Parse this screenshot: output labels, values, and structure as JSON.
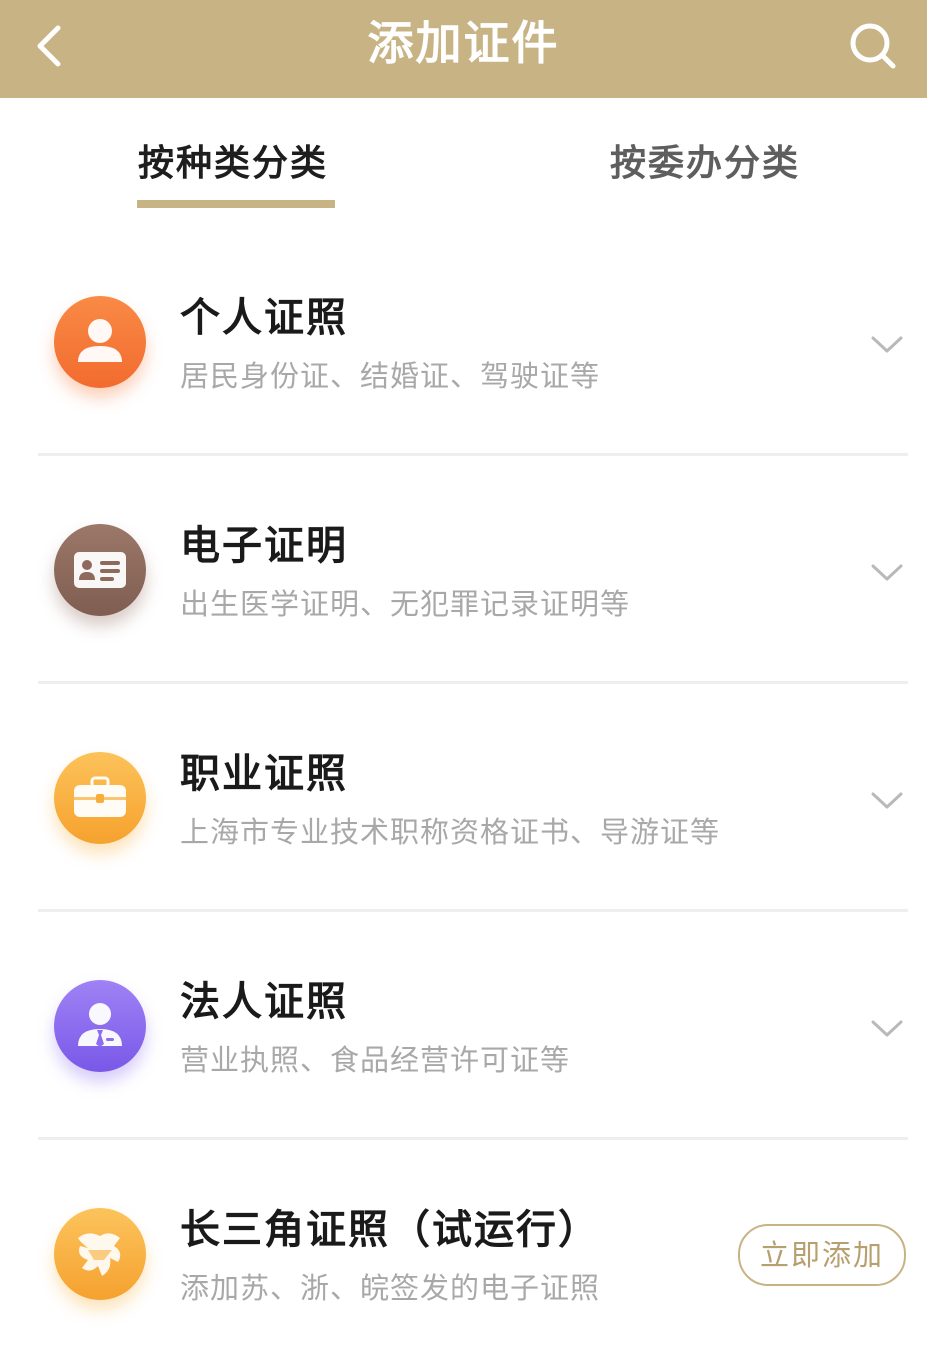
{
  "header": {
    "title": "添加证件",
    "background_color": "#c8b385",
    "back_icon": "chevron-left-icon",
    "search_icon": "search-icon"
  },
  "tabs": [
    {
      "label": "按种类分类",
      "active": true
    },
    {
      "label": "按委办分类",
      "active": false
    }
  ],
  "categories": [
    {
      "name": "个人证照",
      "desc": "居民身份证、结婚证、驾驶证等",
      "icon": "person-icon",
      "icon_color": "#f5793a"
    },
    {
      "name": "电子证明",
      "desc": "出生医学证明、无犯罪记录证明等",
      "icon": "id-card-icon",
      "icon_color": "#8e6a5d"
    },
    {
      "name": "职业证照",
      "desc": "上海市专业技术职称资格证书、导游证等",
      "icon": "briefcase-icon",
      "icon_color": "#f8ae38"
    },
    {
      "name": "法人证照",
      "desc": "营业执照、食品经营许可证等",
      "icon": "business-person-icon",
      "icon_color": "#8c6cf0"
    },
    {
      "name": "长三角证照（试运行）",
      "desc": "添加苏、浙、皖签发的电子证照",
      "icon": "yangtze-delta-icon",
      "icon_color": "#f9b13c",
      "action_label": "立即添加"
    }
  ]
}
